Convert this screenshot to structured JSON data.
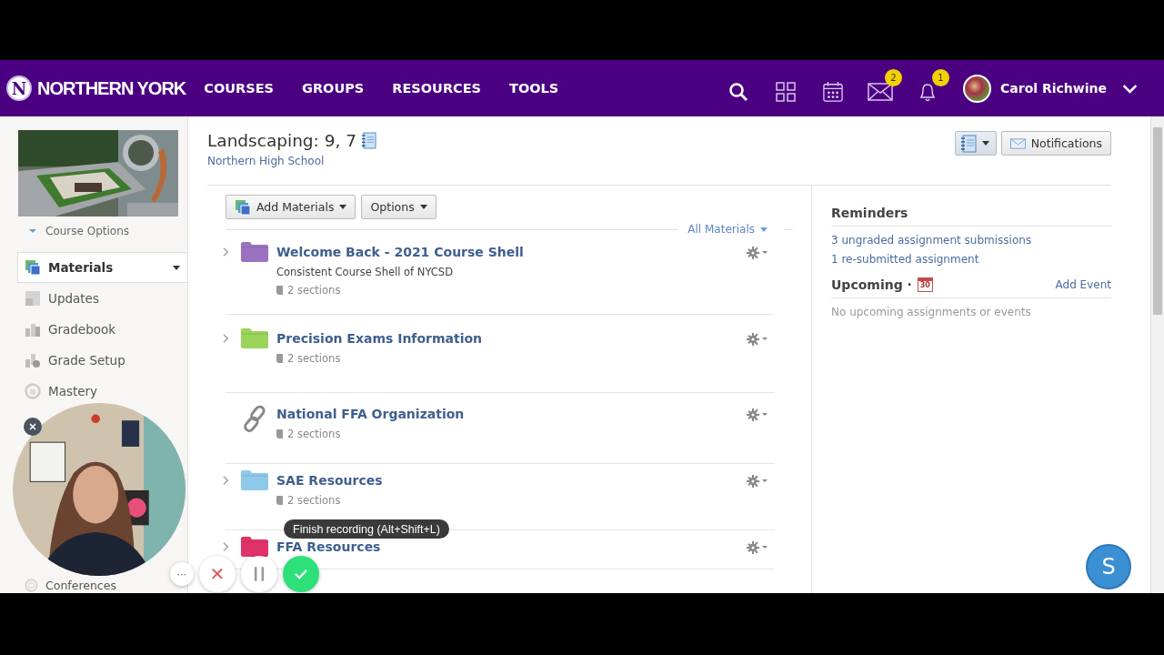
{
  "header": {
    "logo_text": "NORTHERN YORK",
    "logo_letter": "N",
    "nav": [
      {
        "label": "COURSES"
      },
      {
        "label": "GROUPS"
      },
      {
        "label": "RESOURCES"
      },
      {
        "label": "TOOLS"
      }
    ],
    "icons": [
      {
        "kind": "search"
      },
      {
        "kind": "apps"
      },
      {
        "kind": "calendar"
      },
      {
        "kind": "mail",
        "badge": "2"
      },
      {
        "kind": "bell",
        "badge": "1"
      }
    ],
    "user": {
      "name": "Carol Richwine"
    }
  },
  "sidebar": {
    "course_options": "Course Options",
    "items": [
      {
        "label": "Materials",
        "selected": true
      },
      {
        "label": "Updates",
        "selected": false
      },
      {
        "label": "Gradebook",
        "selected": false
      },
      {
        "label": "Grade Setup",
        "selected": false
      },
      {
        "label": "Mastery",
        "selected": false
      },
      {
        "label": "Conferences",
        "selected": false
      }
    ]
  },
  "course": {
    "title": "Landscaping: 9, 7",
    "school": "Northern High School",
    "notifications_button": "Notifications"
  },
  "toolbar": {
    "add_materials": "Add Materials",
    "options": "Options",
    "filter": "All Materials"
  },
  "materials": [
    {
      "kind": "folder",
      "color": "#9b72c2",
      "title": "Welcome Back - 2021 Course Shell",
      "description": "Consistent Course Shell of NYCSD",
      "sections": "2 sections"
    },
    {
      "kind": "folder",
      "color": "#9ad45a",
      "title": "Precision Exams Information",
      "sections": "2 sections"
    },
    {
      "kind": "link",
      "title": "National FFA Organization",
      "sections": "2 sections"
    },
    {
      "kind": "folder",
      "color": "#8ec9ea",
      "title": "SAE Resources",
      "sections": "2 sections"
    },
    {
      "kind": "folder",
      "color": "#e0336a",
      "title": "FFA Resources"
    }
  ],
  "reminders": {
    "title": "Reminders",
    "items": [
      "3 ungraded assignment submissions",
      "1 re-submitted assignment"
    ]
  },
  "upcoming": {
    "title": "Upcoming ·",
    "calendar_day": "30",
    "add_event": "Add Event",
    "empty": "No upcoming assignments or events"
  },
  "recorder": {
    "tooltip": "Finish recording (Alt+Shift+L)",
    "more": "···",
    "cancel": "✕"
  },
  "chat_button": "S"
}
